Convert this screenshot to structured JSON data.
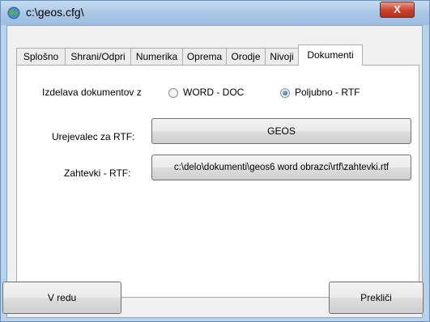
{
  "window": {
    "title": "c:\\geos.cfg\\",
    "close_label": "X"
  },
  "tabs": [
    {
      "label": "Splošno"
    },
    {
      "label": "Shrani/Odpri"
    },
    {
      "label": "Numerika"
    },
    {
      "label": "Oprema"
    },
    {
      "label": "Orodje"
    },
    {
      "label": "Nivoji"
    },
    {
      "label": "Dokumenti",
      "active": true
    }
  ],
  "documents": {
    "source_label": "Izdelava dokumentov z",
    "option_word": "WORD - DOC",
    "option_rtf": "Poljubno - RTF",
    "selected": "Poljubno - RTF",
    "editor_label": "Urejevalec za RTF:",
    "editor_value": "GEOS",
    "requests_label": "Zahtevki - RTF:",
    "requests_value": "c:\\delo\\dokumenti\\geos6 word obrazci\\rtf\\zahtevki.rtf"
  },
  "footer": {
    "ok_label": "V redu",
    "cancel_label": "Prekliči"
  }
}
